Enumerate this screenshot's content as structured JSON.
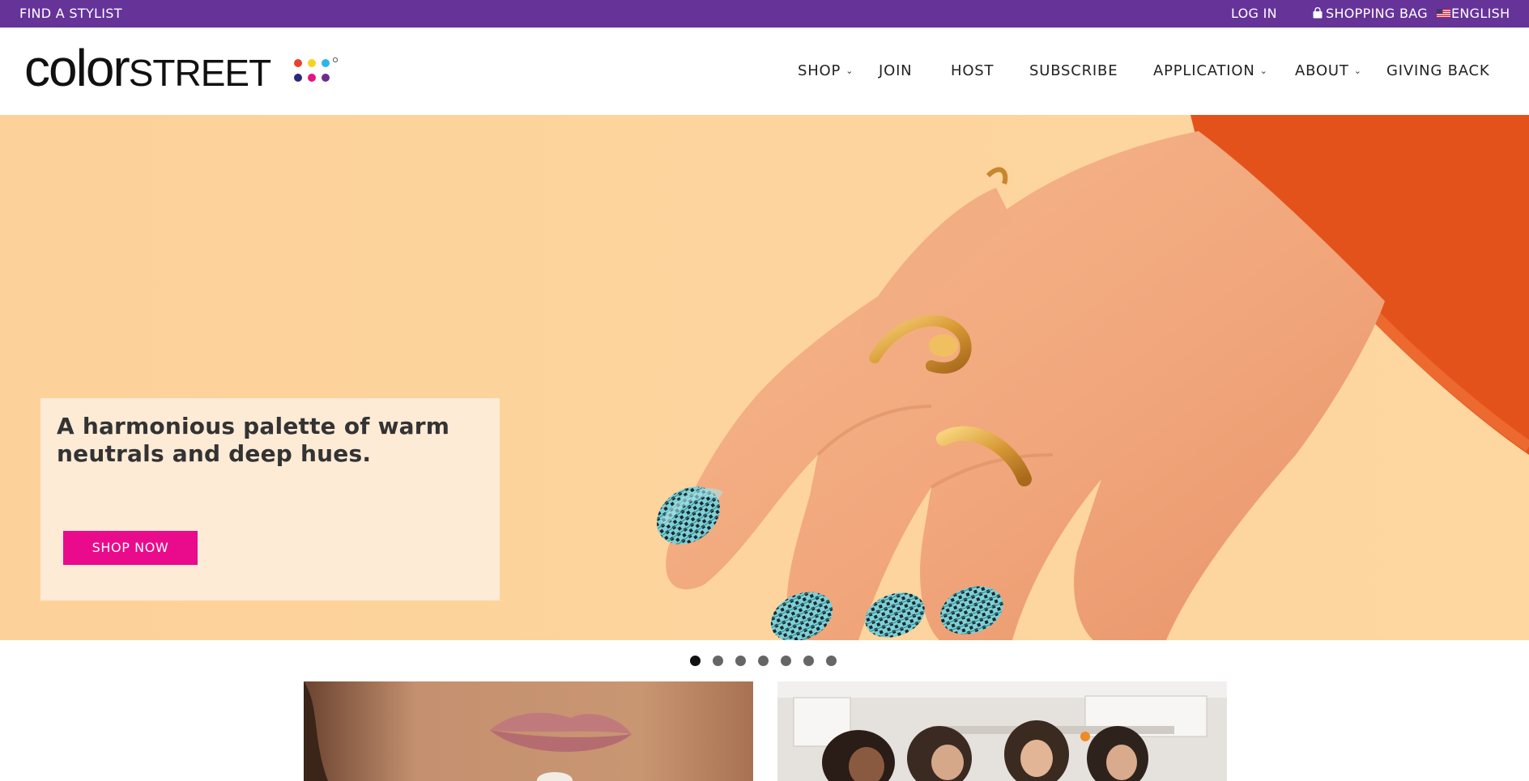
{
  "topbar": {
    "find_stylist": "FIND A STYLIST",
    "login": "LOG IN",
    "shopping_bag": "SHOPPING BAG",
    "language": "ENGLISH",
    "background_color": "#663399"
  },
  "logo": {
    "part1": "color",
    "part2": "STREET",
    "dot_colors": [
      "#e8432e",
      "#f5d41f",
      "#2bb6e8",
      "#2a2a7a",
      "#e6147f",
      "#6c2d91"
    ]
  },
  "nav": {
    "items": [
      {
        "label": "SHOP",
        "has_dropdown": true
      },
      {
        "label": "JOIN",
        "has_dropdown": false
      },
      {
        "label": "HOST",
        "has_dropdown": false
      },
      {
        "label": "SUBSCRIBE",
        "has_dropdown": false
      },
      {
        "label": "APPLICATION",
        "has_dropdown": true
      },
      {
        "label": "ABOUT",
        "has_dropdown": true
      },
      {
        "label": "GIVING BACK",
        "has_dropdown": false
      }
    ]
  },
  "hero": {
    "headline": "A harmonious palette of warm neutrals and deep hues.",
    "cta_label": "SHOP NOW",
    "cta_color": "#ea0a8c",
    "background_color": "#fdd49a",
    "image_description_icon": "hand-with-plaid-nails-image"
  },
  "carousel": {
    "slide_count": 7,
    "active_index": 0
  },
  "tiles": [
    {
      "image": "lips-image"
    },
    {
      "image": "friends-kitchen-image"
    }
  ]
}
